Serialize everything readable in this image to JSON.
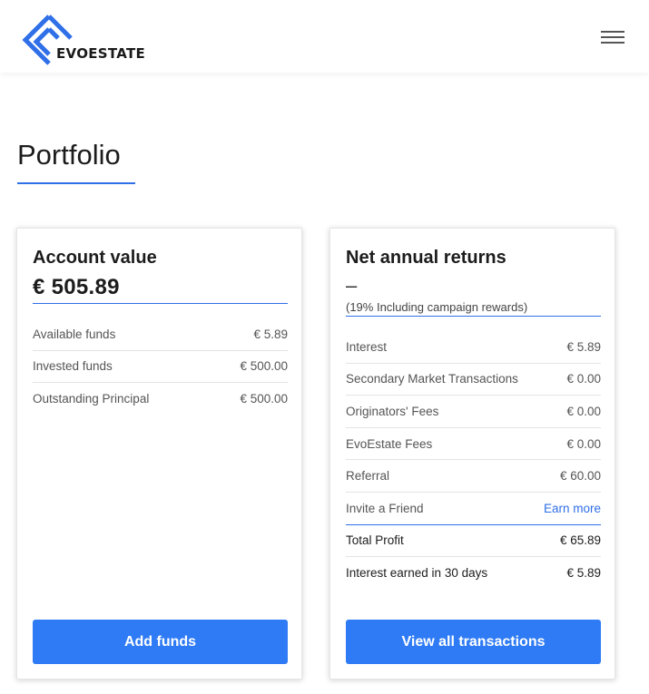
{
  "header": {
    "logo_text": "EVOESTATE",
    "brand_color": "#2f6fe8",
    "menu_icon": "hamburger-menu-icon"
  },
  "page": {
    "title": "Portfolio"
  },
  "account_card": {
    "heading": "Account value",
    "value": "€ 505.89",
    "rows": [
      {
        "label": "Available funds",
        "value": "€ 5.89"
      },
      {
        "label": "Invested funds",
        "value": "€ 500.00"
      },
      {
        "label": "Outstanding Principal",
        "value": "€ 500.00"
      }
    ],
    "button_label": "Add funds"
  },
  "returns_card": {
    "heading": "Net annual returns",
    "value": "–",
    "note": "(19% Including campaign rewards)",
    "rows": [
      {
        "label": "Interest",
        "value": "€ 5.89"
      },
      {
        "label": "Secondary Market Transactions",
        "value": "€ 0.00"
      },
      {
        "label": "Originators' Fees",
        "value": "€ 0.00"
      },
      {
        "label": "EvoEstate Fees",
        "value": "€ 0.00"
      },
      {
        "label": "Referral",
        "value": "€ 60.00"
      },
      {
        "label": "Invite a Friend",
        "value": "Earn more"
      },
      {
        "label": "Total Profit",
        "value": "€ 65.89"
      },
      {
        "label": "Interest earned in 30 days",
        "value": "€ 5.89"
      }
    ],
    "button_label": "View all transactions"
  }
}
